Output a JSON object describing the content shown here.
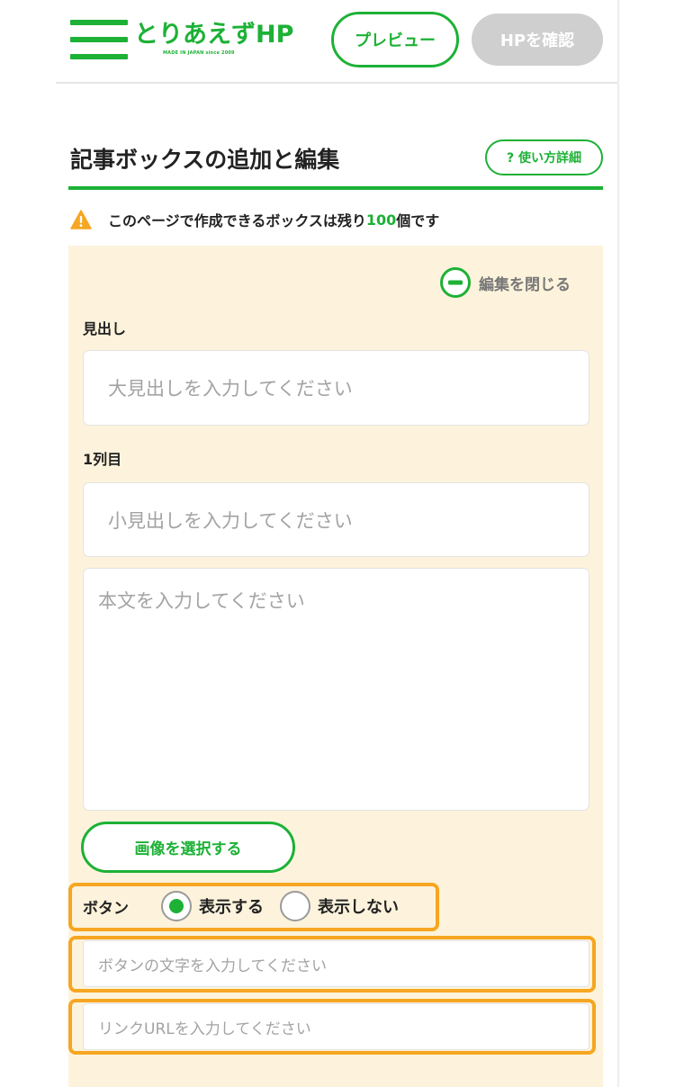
{
  "header": {
    "logo_text": "とりあえずHP",
    "logo_tagline": "MADE IN JAPAN since 2009",
    "preview_label": "プレビュー",
    "confirm_label": "HPを確認"
  },
  "title": {
    "text": "記事ボックスの追加と編集",
    "help_label": "? 使い方詳細"
  },
  "notice": {
    "prefix": "このページで作成できるボックスは残り",
    "count": "100",
    "suffix": "個です"
  },
  "editor": {
    "close_label": "編集を閉じる",
    "heading_label": "見出し",
    "heading_placeholder": "大見出しを入力してください",
    "column_label": "1列目",
    "subheading_placeholder": "小見出しを入力してください",
    "body_placeholder": "本文を入力してください",
    "select_image_label": "画像を選択する",
    "button_label": "ボタン",
    "show_label": "表示する",
    "hide_label": "表示しない",
    "button_text_placeholder": "ボタンの文字を入力してください",
    "link_url_placeholder": "リンクURLを入力してください"
  },
  "colors": {
    "accent": "#1db136",
    "panel": "#fdf3dc",
    "highlight": "#f6a621"
  }
}
